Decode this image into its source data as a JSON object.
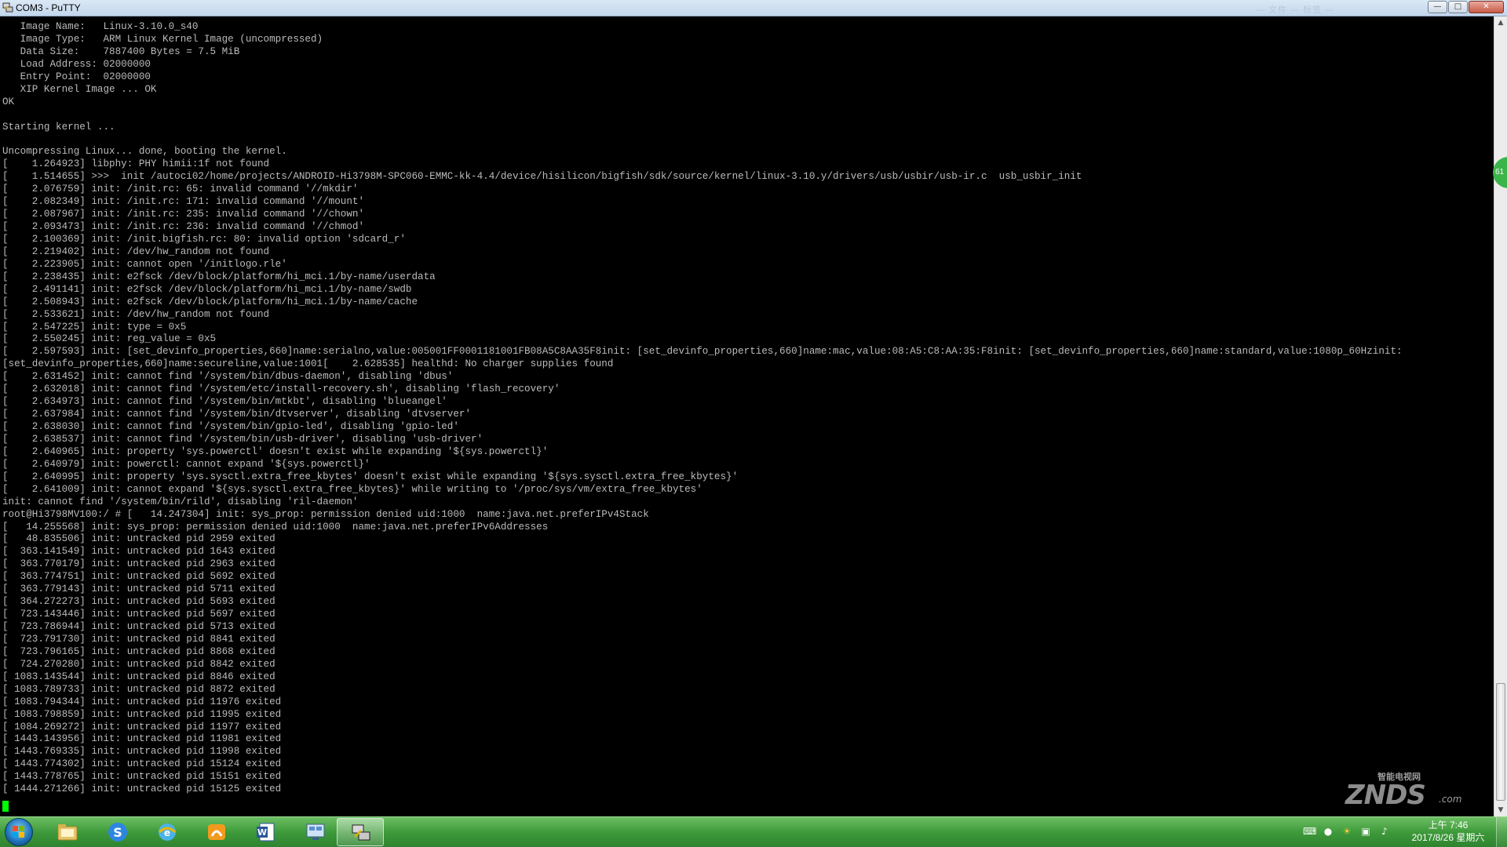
{
  "window": {
    "title": "COM3 - PuTTY",
    "title_faded": "— 文件 — 标签 —",
    "min_label": "—",
    "max_label": "□",
    "close_label": "✕"
  },
  "terminal": {
    "lines": [
      "   Image Name:   Linux-3.10.0_s40",
      "   Image Type:   ARM Linux Kernel Image (uncompressed)",
      "   Data Size:    7887400 Bytes = 7.5 MiB",
      "   Load Address: 02000000",
      "   Entry Point:  02000000",
      "   XIP Kernel Image ... OK",
      "OK",
      "",
      "Starting kernel ...",
      "",
      "Uncompressing Linux... done, booting the kernel.",
      "[    1.264923] libphy: PHY himii:1f not found",
      "[    1.514655] >>>  init /autoci02/home/projects/ANDROID-Hi3798M-SPC060-EMMC-kk-4.4/device/hisilicon/bigfish/sdk/source/kernel/linux-3.10.y/drivers/usb/usbir/usb-ir.c  usb_usbir_init",
      "[    2.076759] init: /init.rc: 65: invalid command '//mkdir'",
      "[    2.082349] init: /init.rc: 171: invalid command '//mount'",
      "[    2.087967] init: /init.rc: 235: invalid command '//chown'",
      "[    2.093473] init: /init.rc: 236: invalid command '//chmod'",
      "[    2.100369] init: /init.bigfish.rc: 80: invalid option 'sdcard_r'",
      "[    2.219402] init: /dev/hw_random not found",
      "[    2.223905] init: cannot open '/initlogo.rle'",
      "[    2.238435] init: e2fsck /dev/block/platform/hi_mci.1/by-name/userdata",
      "[    2.491141] init: e2fsck /dev/block/platform/hi_mci.1/by-name/swdb",
      "[    2.508943] init: e2fsck /dev/block/platform/hi_mci.1/by-name/cache",
      "[    2.533621] init: /dev/hw_random not found",
      "[    2.547225] init: type = 0x5",
      "[    2.550245] init: reg_value = 0x5",
      "[    2.597593] init: [set_devinfo_properties,660]name:serialno,value:005001FF0001181001FB08A5C8AA35F8init: [set_devinfo_properties,660]name:mac,value:08:A5:C8:AA:35:F8init: [set_devinfo_properties,660]name:standard,value:1080p_60Hzinit:",
      "[set_devinfo_properties,660]name:secureline,value:1001[    2.628535] healthd: No charger supplies found",
      "[    2.631452] init: cannot find '/system/bin/dbus-daemon', disabling 'dbus'",
      "[    2.632018] init: cannot find '/system/etc/install-recovery.sh', disabling 'flash_recovery'",
      "[    2.634973] init: cannot find '/system/bin/mtkbt', disabling 'blueangel'",
      "[    2.637984] init: cannot find '/system/bin/dtvserver', disabling 'dtvserver'",
      "[    2.638030] init: cannot find '/system/bin/gpio-led', disabling 'gpio-led'",
      "[    2.638537] init: cannot find '/system/bin/usb-driver', disabling 'usb-driver'",
      "[    2.640965] init: property 'sys.powerctl' doesn't exist while expanding '${sys.powerctl}'",
      "[    2.640979] init: powerctl: cannot expand '${sys.powerctl}'",
      "[    2.640995] init: property 'sys.sysctl.extra_free_kbytes' doesn't exist while expanding '${sys.sysctl.extra_free_kbytes}'",
      "[    2.641009] init: cannot expand '${sys.sysctl.extra_free_kbytes}' while writing to '/proc/sys/vm/extra_free_kbytes'",
      "init: cannot find '/system/bin/rild', disabling 'ril-daemon'",
      "root@Hi3798MV100:/ # [   14.247304] init: sys_prop: permission denied uid:1000  name:java.net.preferIPv4Stack",
      "[   14.255568] init: sys_prop: permission denied uid:1000  name:java.net.preferIPv6Addresses",
      "[   48.835506] init: untracked pid 2959 exited",
      "[  363.141549] init: untracked pid 1643 exited",
      "[  363.770179] init: untracked pid 2963 exited",
      "[  363.774751] init: untracked pid 5692 exited",
      "[  363.779143] init: untracked pid 5711 exited",
      "[  364.272273] init: untracked pid 5693 exited",
      "[  723.143446] init: untracked pid 5697 exited",
      "[  723.786944] init: untracked pid 5713 exited",
      "[  723.791730] init: untracked pid 8841 exited",
      "[  723.796165] init: untracked pid 8868 exited",
      "[  724.270280] init: untracked pid 8842 exited",
      "[ 1083.143544] init: untracked pid 8846 exited",
      "[ 1083.789733] init: untracked pid 8872 exited",
      "[ 1083.794344] init: untracked pid 11976 exited",
      "[ 1083.798859] init: untracked pid 11995 exited",
      "[ 1084.269272] init: untracked pid 11977 exited",
      "[ 1443.143956] init: untracked pid 11981 exited",
      "[ 1443.769335] init: untracked pid 11998 exited",
      "[ 1443.774302] init: untracked pid 15124 exited",
      "[ 1443.778765] init: untracked pid 15151 exited",
      "[ 1444.271266] init: untracked pid 15125 exited"
    ]
  },
  "side_badge": "61",
  "watermark": {
    "small": "智能电视网",
    "big": "ZNDS",
    "suffix": ".com"
  },
  "taskbar": {
    "apps": [
      {
        "name": "explorer",
        "icon": "folder-icon"
      },
      {
        "name": "sogou",
        "icon": "s-app-icon"
      },
      {
        "name": "browser",
        "icon": "browser-icon"
      },
      {
        "name": "uc",
        "icon": "fox-icon"
      },
      {
        "name": "word",
        "icon": "word-icon"
      },
      {
        "name": "remote",
        "icon": "network-icon"
      },
      {
        "name": "putty",
        "icon": "putty-icon"
      }
    ],
    "tray_icons": [
      "keyboard-icon",
      "qq-icon",
      "sun-icon",
      "network-icon",
      "volume-icon"
    ],
    "clock_time": "上午 7:46",
    "clock_date": "2017/8/26 星期六"
  },
  "colors": {
    "terminal_text": "#bbbbbb",
    "cursor": "#00ff00",
    "taskbar": "#3e9a3a"
  }
}
